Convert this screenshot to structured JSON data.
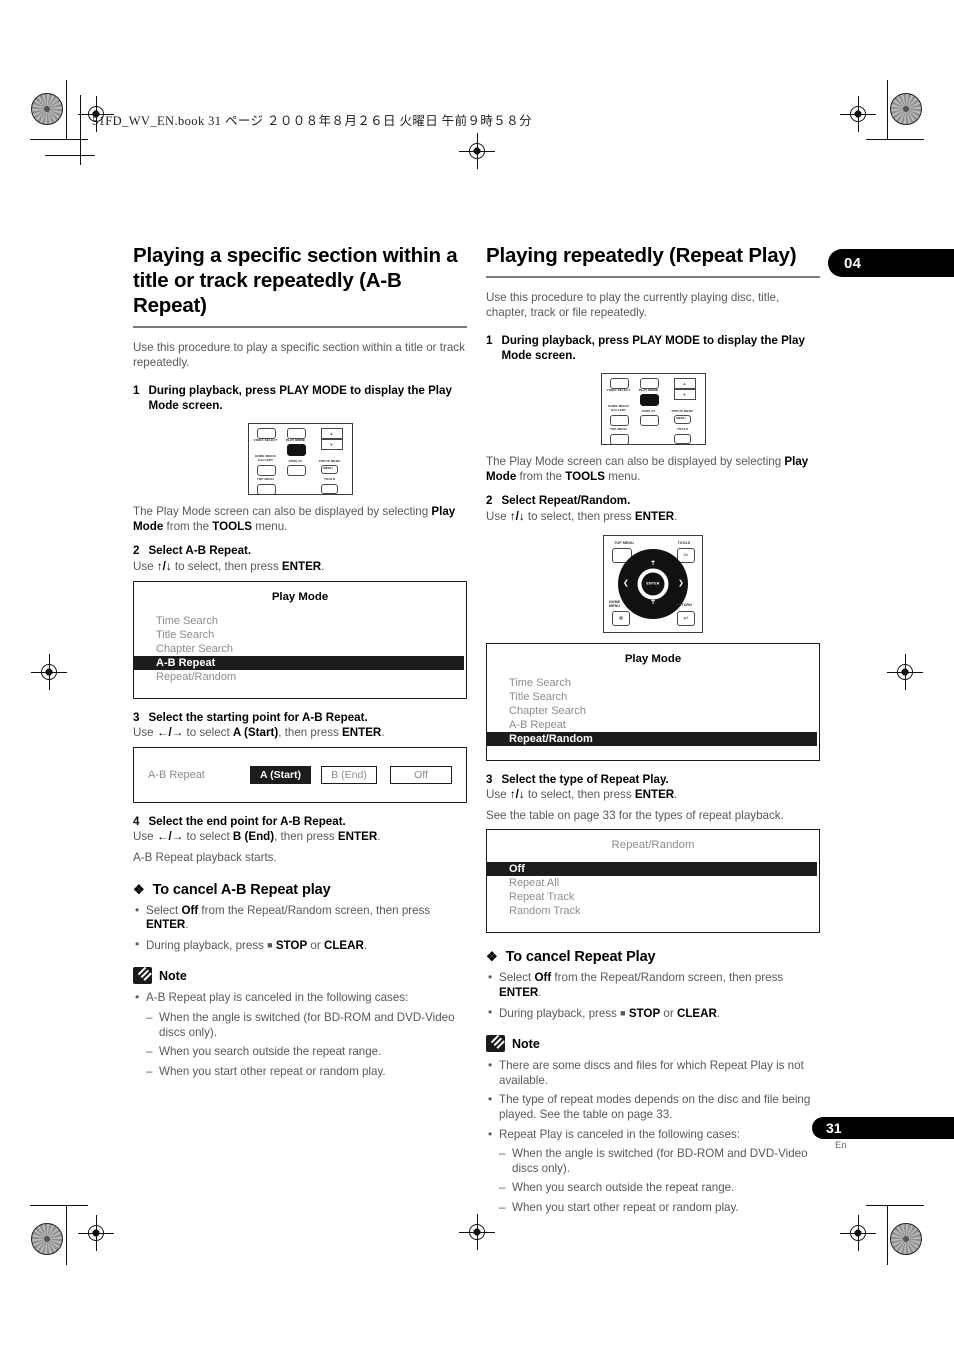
{
  "imprint": "51FD_WV_EN.book   31 ページ   ２００８年８月２６日   火曜日   午前９時５８分",
  "chapter_tab": "04",
  "page_number": "31",
  "page_lang": "En",
  "left": {
    "heading": "Playing a specific section within a title or track repeatedly (A-B Repeat)",
    "intro": "Use this procedure to play a specific section within a title or track repeatedly.",
    "step1_num": "1",
    "step1_text": "During playback, press PLAY MODE to display the Play Mode screen.",
    "remote_caption_a": "The Play Mode screen can also be displayed by selecting ",
    "remote_caption_b": "Play Mode",
    "remote_caption_c": " from the ",
    "remote_caption_d": "TOOLS",
    "remote_caption_e": " menu.",
    "step2_num": "2",
    "step2_text": "Select A-B Repeat.",
    "step2_sub_a": "Use ",
    "step2_sub_arrows": "↑/↓",
    "step2_sub_b": " to select, then press ",
    "step2_sub_enter": "ENTER",
    "step2_sub_c": ".",
    "playmode_title": "Play Mode",
    "playmode_items": [
      {
        "label": "Time Search",
        "selected": false
      },
      {
        "label": "Title Search",
        "selected": false
      },
      {
        "label": "Chapter Search",
        "selected": false
      },
      {
        "label": "A-B Repeat",
        "selected": true
      },
      {
        "label": "Repeat/Random",
        "selected": false
      }
    ],
    "step3_num": "3",
    "step3_text": "Select the starting point for A-B Repeat.",
    "step3_sub_a": "Use ",
    "step3_sub_arrows": "←/→",
    "step3_sub_b": " to select ",
    "step3_sub_target": "A (Start)",
    "step3_sub_c": ", then press ",
    "step3_sub_enter": "ENTER",
    "step3_sub_d": ".",
    "ab_screen": {
      "label": "A-B Repeat",
      "chip_a": "A (Start)",
      "chip_b": "B (End)",
      "chip_off": "Off"
    },
    "step4_num": "4",
    "step4_text": "Select the end point for A-B Repeat.",
    "step4_sub_a": "Use ",
    "step4_sub_arrows": "←/→",
    "step4_sub_b": " to select ",
    "step4_sub_target": "B (End)",
    "step4_sub_c": ", then press ",
    "step4_sub_enter": "ENTER",
    "step4_sub_d": ".",
    "step4_result": "A-B Repeat playback starts.",
    "cancel_heading": "To cancel A-B Repeat play",
    "cancel_b1_a": "Select ",
    "cancel_b1_off": "Off",
    "cancel_b1_b": " from the Repeat/Random screen, then press ",
    "cancel_b1_enter": "ENTER",
    "cancel_b1_c": ".",
    "cancel_b2_a": "During playback, press ",
    "cancel_b2_stop": "STOP",
    "cancel_b2_b": " or ",
    "cancel_b2_clear": "CLEAR",
    "cancel_b2_c": ".",
    "note_label": "Note",
    "note_bullet": "A-B Repeat play is canceled in the following cases:",
    "note_dashes": [
      "When the angle is switched (for BD-ROM and DVD-Video discs only).",
      "When you search outside the repeat range.",
      "When you start other repeat or random play."
    ]
  },
  "right": {
    "heading": "Playing repeatedly (Repeat Play)",
    "intro": "Use this procedure to play the currently playing disc, title, chapter, track or file repeatedly.",
    "step1_num": "1",
    "step1_text": "During playback, press PLAY MODE to display the Play Mode screen.",
    "remote_caption_a": "The Play Mode screen can also be displayed by selecting ",
    "remote_caption_b": "Play Mode",
    "remote_caption_c": " from the ",
    "remote_caption_d": "TOOLS",
    "remote_caption_e": " menu.",
    "step2_num": "2",
    "step2_text": "Select Repeat/Random.",
    "step2_sub_a": "Use ",
    "step2_sub_arrows": "↑/↓",
    "step2_sub_b": " to select, then press ",
    "step2_sub_enter": "ENTER",
    "step2_sub_c": ".",
    "playmode_title": "Play Mode",
    "playmode_items": [
      {
        "label": "Time Search",
        "selected": false
      },
      {
        "label": "Title Search",
        "selected": false
      },
      {
        "label": "Chapter Search",
        "selected": false
      },
      {
        "label": "A-B Repeat",
        "selected": false
      },
      {
        "label": "Repeat/Random",
        "selected": true
      }
    ],
    "step3_num": "3",
    "step3_text": "Select the type of Repeat Play.",
    "step3_sub_a": "Use ",
    "step3_sub_arrows": "↑/↓",
    "step3_sub_b": " to select, then press ",
    "step3_sub_enter": "ENTER",
    "step3_sub_c": ".",
    "step3_note": "See the table on page 33 for the types of repeat playback.",
    "repeat_title": "Repeat/Random",
    "repeat_items": [
      {
        "label": "Off",
        "selected": true
      },
      {
        "label": "Repeat All",
        "selected": false
      },
      {
        "label": "Repeat Track",
        "selected": false
      },
      {
        "label": "Random Track",
        "selected": false
      }
    ],
    "cancel_heading": "To cancel Repeat Play",
    "cancel_b1_a": "Select ",
    "cancel_b1_off": "Off",
    "cancel_b1_b": " from the Repeat/Random screen, then press ",
    "cancel_b1_enter": "ENTER",
    "cancel_b1_c": ".",
    "cancel_b2_a": "During playback, press ",
    "cancel_b2_stop": "STOP",
    "cancel_b2_b": " or ",
    "cancel_b2_clear": "CLEAR",
    "cancel_b2_c": ".",
    "note_label": "Note",
    "note_bullets": [
      "There are some discs and files for which Repeat Play is not available.",
      "The type of repeat modes depends on the disc and file being played. See the table on page 33.",
      "Repeat Play is canceled in the following cases:"
    ],
    "note_dashes": [
      "When the angle is switched (for BD-ROM and DVD-Video discs only).",
      "When you search outside the repeat range.",
      "When you start other repeat or random play."
    ]
  },
  "remote_buttons": {
    "video_select": "VIDEO SELECT",
    "play_mode": "PLAY MODE",
    "home_media_gallery": "HOME MEDIA\nGALLERY",
    "display": "DISPLAY",
    "popup_menu": "POPUP MENU",
    "menu": "MENU",
    "top_menu": "TOP MENU",
    "tools": "TOOLS",
    "home_menu": "HOME\nMENU",
    "return": "RETURN",
    "enter": "ENTER"
  }
}
